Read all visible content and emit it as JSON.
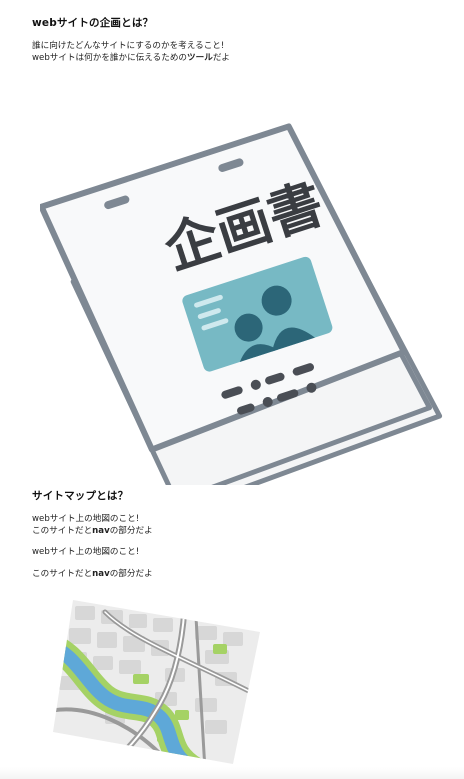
{
  "section1": {
    "heading": "webサイトの企画とは？",
    "line1": "誰に向けたどんなサイトにするのかを考えること!",
    "line2_pre": "webサイトは何かを誰かに伝えるための",
    "line2_bold": "ツール",
    "line2_post": "だよ",
    "illustration": {
      "title": "企画書",
      "icon": "planning-document-illustration",
      "colors": {
        "outline": "#7e8893",
        "paper": "#f7f8f9",
        "ink": "#3a3d42",
        "photo_bg": "#77b9c4",
        "photo_dark": "#2c6678",
        "photo_light": "#cfe9ee"
      }
    }
  },
  "section2": {
    "heading": "サイトマップとは？",
    "p1_line1": "webサイト上の地図のこと!",
    "p1_line2_pre": "このサイトだと",
    "p1_line2_bold": "nav",
    "p1_line2_post": "の部分だよ",
    "p2": "webサイト上の地図のこと!",
    "p3_pre": "このサイトだと",
    "p3_bold": "nav",
    "p3_post": "の部分だよ",
    "illustration": {
      "icon": "city-map-illustration",
      "colors": {
        "ground": "#ececec",
        "block": "#d7d7d7",
        "road": "#9a9a9a",
        "park": "#a5d265",
        "river": "#5ea8d8"
      }
    }
  }
}
